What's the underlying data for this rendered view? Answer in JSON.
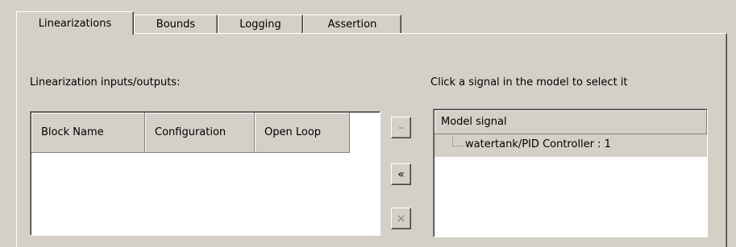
{
  "tabs": [
    {
      "label": "Linearizations",
      "active": true
    },
    {
      "label": "Bounds",
      "active": false
    },
    {
      "label": "Logging",
      "active": false
    },
    {
      "label": "Assertion",
      "active": false
    }
  ],
  "linearization": {
    "io_label": "Linearization inputs/outputs:",
    "columns": [
      "Block Name",
      "Configuration",
      "Open Loop"
    ],
    "rows": []
  },
  "buttons": {
    "remove": {
      "glyph": "–",
      "enabled": false
    },
    "add": {
      "glyph": "«",
      "enabled": true
    },
    "delete": {
      "glyph": "×",
      "enabled": false
    }
  },
  "signal_panel": {
    "hint": "Click a signal in the model to select it",
    "header": "Model signal",
    "items": [
      "watertank/PID Controller : 1"
    ]
  }
}
